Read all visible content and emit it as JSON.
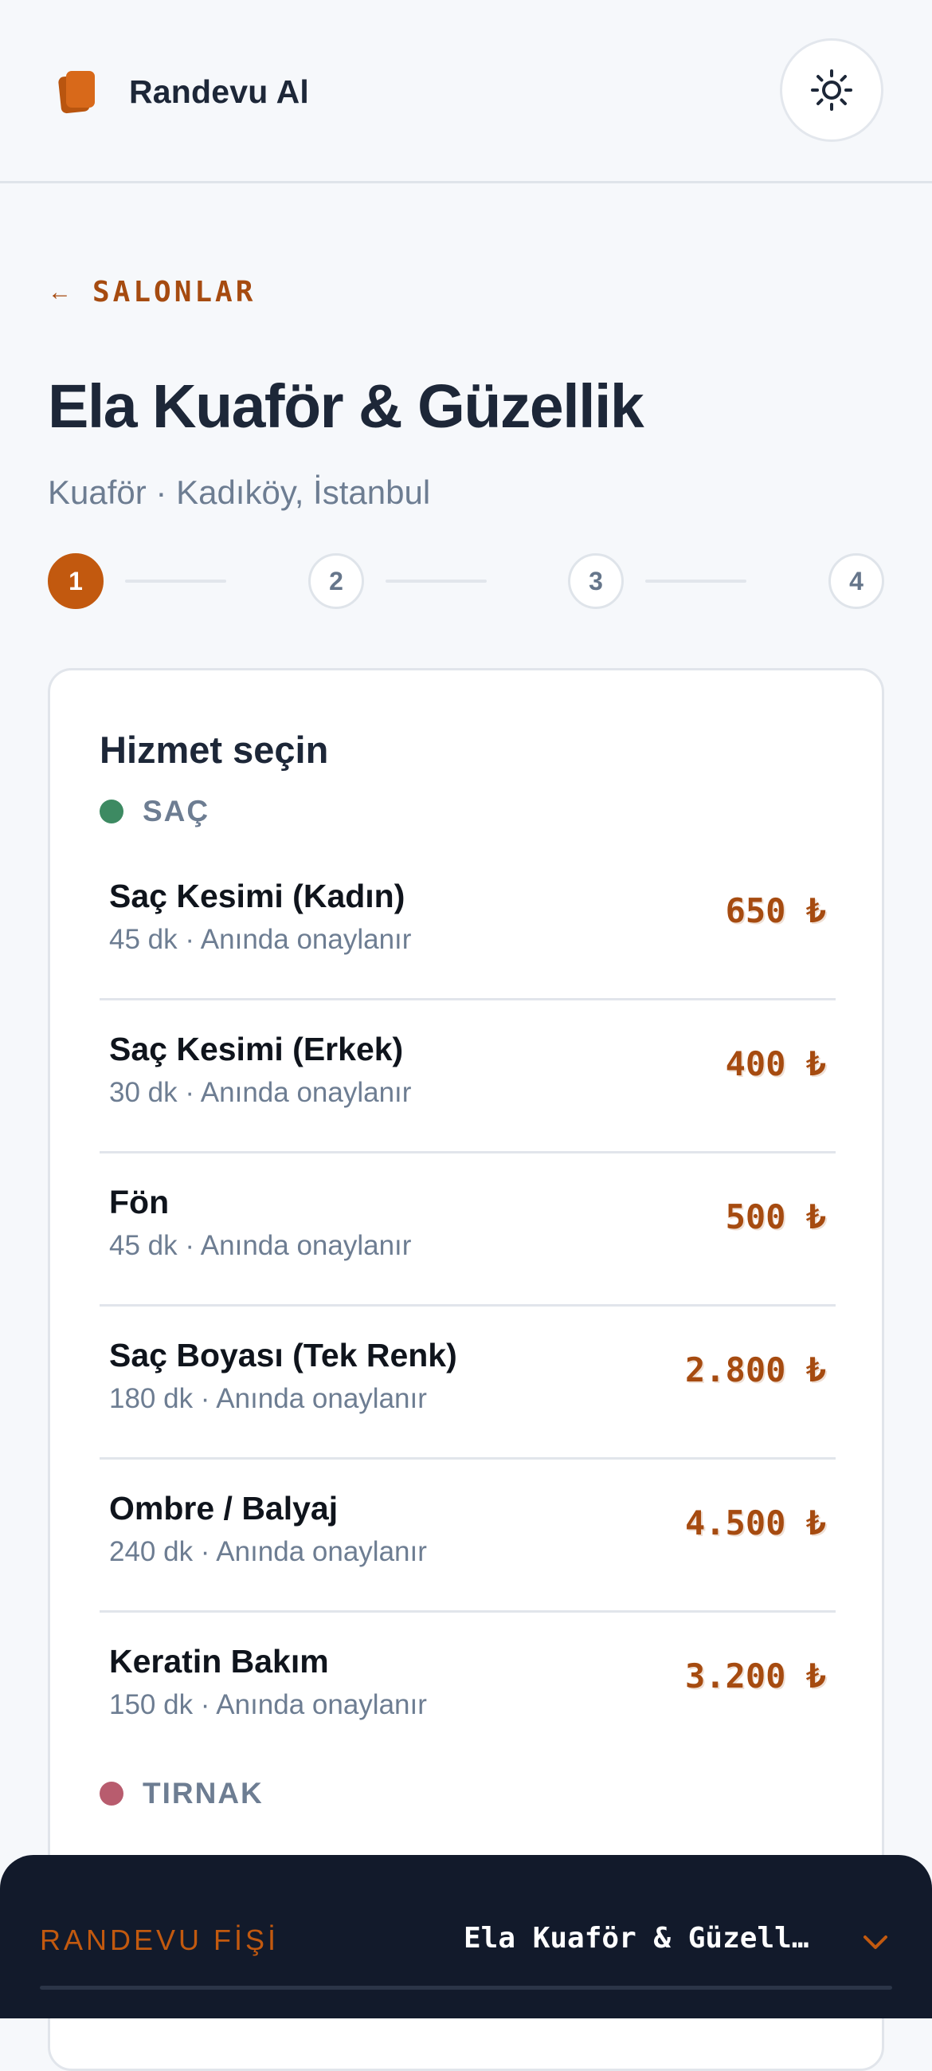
{
  "header": {
    "brand_name": "Randevu Al",
    "brand_icon": "cards-icon",
    "theme_toggle_icon": "sun-icon"
  },
  "nav": {
    "back_arrow": "←",
    "back_label": "SALONLAR"
  },
  "salon": {
    "name": "Ela Kuaför & Güzellik",
    "subtitle": "Kuaför · Kadıköy, İstanbul"
  },
  "stepper": {
    "current": 1,
    "steps": [
      "1",
      "2",
      "3",
      "4"
    ]
  },
  "services_card": {
    "title": "Hizmet seçin",
    "categories": [
      {
        "label": "SAÇ",
        "color": "#3d8a62",
        "services": [
          {
            "name": "Saç Kesimi (Kadın)",
            "meta": "45 dk · Anında onaylanır",
            "price": "650 ₺"
          },
          {
            "name": "Saç Kesimi (Erkek)",
            "meta": "30 dk · Anında onaylanır",
            "price": "400 ₺"
          },
          {
            "name": "Fön",
            "meta": "45 dk · Anında onaylanır",
            "price": "500 ₺"
          },
          {
            "name": "Saç Boyası (Tek Renk)",
            "meta": "180 dk · Anında onaylanır",
            "price": "2.800 ₺"
          },
          {
            "name": "Ombre / Balyaj",
            "meta": "240 dk · Anında onaylanır",
            "price": "4.500 ₺"
          },
          {
            "name": "Keratin Bakım",
            "meta": "150 dk · Anında onaylanır",
            "price": "3.200 ₺"
          }
        ]
      },
      {
        "label": "TIRNAK",
        "color": "#b85c6e",
        "services": []
      }
    ]
  },
  "receipt": {
    "label": "RANDEVU FİŞİ",
    "salon_name": "Ela Kuaför & Güzellik",
    "toggle_icon": "chevron-down-icon"
  },
  "colors": {
    "accent": "#c2590f",
    "accent_text": "#a64b10",
    "navy": "#121a2b",
    "muted": "#6d7d92",
    "background": "#f6f8fb"
  }
}
